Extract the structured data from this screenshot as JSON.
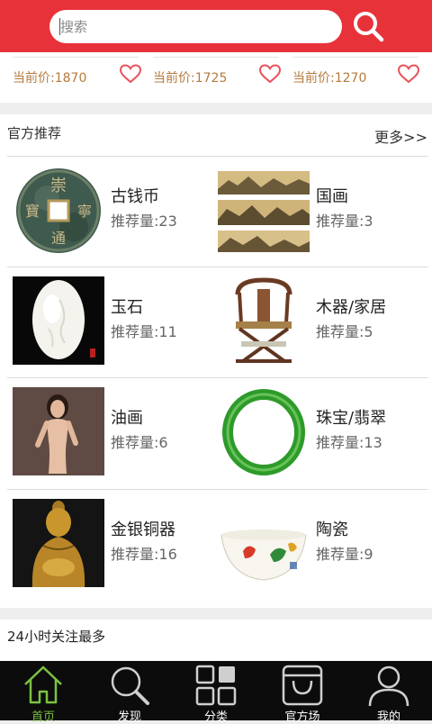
{
  "header": {
    "search_placeholder": "搜索",
    "search_icon": "search-icon"
  },
  "prices": [
    {
      "label": "当前价:1870",
      "icon": "heart-icon"
    },
    {
      "label": "当前价:1725",
      "icon": "heart-icon"
    },
    {
      "label": "当前价:1270",
      "icon": "heart-icon"
    }
  ],
  "recommend": {
    "title": "官方推荐",
    "more": "更多>>",
    "categories": [
      {
        "name": "古钱币",
        "count": "推荐量:23"
      },
      {
        "name": "国画",
        "count": "推荐量:3"
      },
      {
        "name": "玉石",
        "count": "推荐量:11"
      },
      {
        "name": "木器/家居",
        "count": "推荐量:5"
      },
      {
        "name": "油画",
        "count": "推荐量:6"
      },
      {
        "name": "珠宝/翡翠",
        "count": "推荐量:13"
      },
      {
        "name": "金银铜器",
        "count": "推荐量:16"
      },
      {
        "name": "陶瓷",
        "count": "推荐量:9"
      }
    ]
  },
  "hot": {
    "title": "24小时关注最多"
  },
  "colors": {
    "brand_red": "#e8323a",
    "price_brown": "#b57a3c",
    "active_green": "#7bc242",
    "tabbar_bg": "#0c0c0c"
  },
  "tabs": [
    {
      "label": "首页",
      "icon": "home-icon",
      "active": true
    },
    {
      "label": "发现",
      "icon": "magnifier-icon",
      "active": false
    },
    {
      "label": "分类",
      "icon": "grid-icon",
      "active": false
    },
    {
      "label": "官方场",
      "icon": "bag-icon",
      "active": false
    },
    {
      "label": "我的",
      "icon": "user-icon",
      "active": false
    }
  ]
}
